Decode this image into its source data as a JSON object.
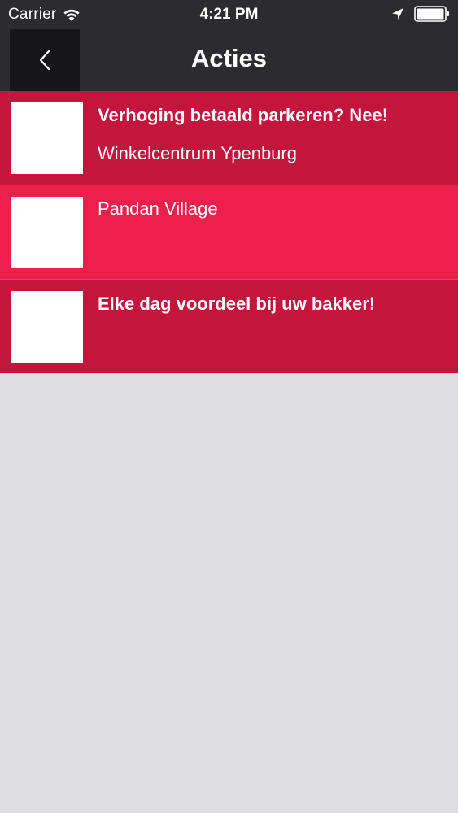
{
  "status_bar": {
    "carrier": "Carrier",
    "time": "4:21 PM",
    "icons": [
      "wifi-icon",
      "location-arrow-icon",
      "battery-icon"
    ]
  },
  "nav": {
    "title": "Acties",
    "back_icon": "chevron-left-icon"
  },
  "items": [
    {
      "title": "Verhoging betaald parkeren? Nee!",
      "subtitle": "Winkelcentrum Ypenburg"
    },
    {
      "title": "",
      "subtitle": "Pandan Village"
    },
    {
      "title": "Elke dag voordeel bij uw bakker!",
      "subtitle": ""
    }
  ],
  "colors": {
    "header_bg": "#2c2b2e",
    "back_button_bg": "#161517",
    "row_bg": "#c4153c",
    "row_highlight_bg": "#ee1f4b",
    "page_bg": "#dfdee0"
  }
}
